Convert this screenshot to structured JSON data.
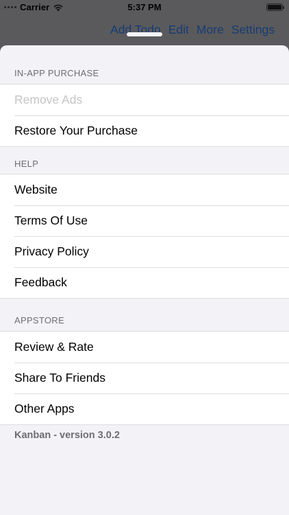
{
  "status_bar": {
    "carrier": "Carrier",
    "time": "5:37 PM",
    "signal_icon": "signal-dots-icon",
    "wifi_icon": "wifi-icon",
    "battery_icon": "battery-icon"
  },
  "nav": {
    "actions": [
      "Add Todo",
      "Edit",
      "More",
      "Settings"
    ],
    "color": "#173c74"
  },
  "settings": {
    "sections": [
      {
        "header": "IN-APP PURCHASE",
        "rows": [
          {
            "label": "Remove Ads",
            "disabled": true
          },
          {
            "label": "Restore Your Purchase",
            "disabled": false
          }
        ]
      },
      {
        "header": "HELP",
        "rows": [
          {
            "label": "Website",
            "disabled": false
          },
          {
            "label": "Terms Of Use",
            "disabled": false
          },
          {
            "label": "Privacy Policy",
            "disabled": false
          },
          {
            "label": "Feedback",
            "disabled": false
          }
        ]
      },
      {
        "header": "APPSTORE",
        "rows": [
          {
            "label": "Review & Rate",
            "disabled": false
          },
          {
            "label": "Share To Friends",
            "disabled": false
          },
          {
            "label": "Other Apps",
            "disabled": false
          }
        ]
      }
    ],
    "footer": "Kanban - version 3.0.2"
  },
  "colors": {
    "sheet_background": "#f2f2f7",
    "disabled_text": "#c4c4c6",
    "section_header_text": "#6d6d72"
  }
}
